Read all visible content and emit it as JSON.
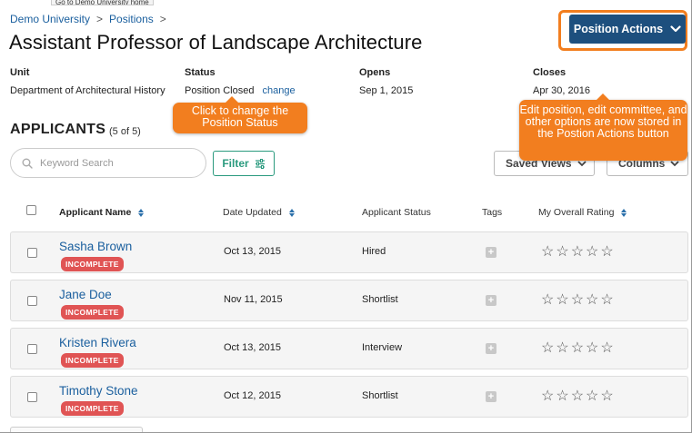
{
  "tooltip": "Go to Demo University home",
  "breadcrumb": {
    "home": "Demo University",
    "positions": "Positions",
    "sep1": ">",
    "sep2": ">"
  },
  "page_title": "Assistant Professor of Landscape Architecture",
  "position_actions": {
    "label": "Position Actions"
  },
  "meta": {
    "unit_label": "Unit",
    "unit_value": "Department of Architectural History",
    "status_label": "Status",
    "status_value": "Position Closed",
    "status_link": "change",
    "opens_label": "Opens",
    "opens_value": "Sep 1, 2015",
    "closes_label": "Closes",
    "closes_value": "Apr 30, 2016"
  },
  "applicants": {
    "title": "APPLICANTS",
    "count": "(5 of 5)"
  },
  "search": {
    "placeholder": "Keyword Search"
  },
  "filter": {
    "label": "Filter"
  },
  "saved_views": {
    "label": "Saved Views"
  },
  "columns_btn": {
    "label": "Columns"
  },
  "callouts": {
    "status": "Click to change the Position Status",
    "actions": "Edit position, edit committee, and other options are now stored in the Postion Actions button"
  },
  "table": {
    "headers": {
      "name": "Applicant Name",
      "date": "Date Updated",
      "status": "Applicant Status",
      "tags": "Tags",
      "rating": "My Overall Rating"
    },
    "rows": [
      {
        "name": "Sasha Brown",
        "badge": "INCOMPLETE",
        "date": "Oct 13, 2015",
        "status": "Hired",
        "tag": "+",
        "stars": "☆☆☆☆☆"
      },
      {
        "name": "Jane Doe",
        "badge": "INCOMPLETE",
        "date": "Nov 11, 2015",
        "status": "Shortlist",
        "tag": "+",
        "stars": "☆☆☆☆☆"
      },
      {
        "name": "Kristen Rivera",
        "badge": "INCOMPLETE",
        "date": "Oct 13, 2015",
        "status": "Interview",
        "tag": "+",
        "stars": "☆☆☆☆☆"
      },
      {
        "name": "Timothy Stone",
        "badge": "INCOMPLETE",
        "date": "Oct 12, 2015",
        "status": "Shortlist",
        "tag": "+",
        "stars": "☆☆☆☆☆"
      }
    ]
  },
  "colors": {
    "accent": "#1d4f7e",
    "link": "#1a5f9e",
    "callout": "#f27e1f",
    "badge": "#e05454",
    "filter": "#2a9a7e"
  }
}
